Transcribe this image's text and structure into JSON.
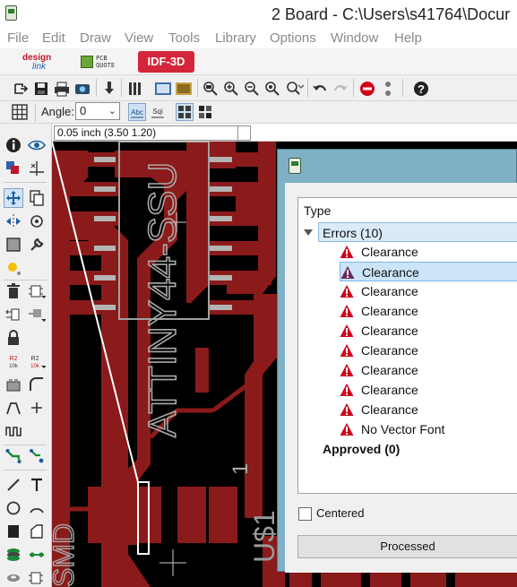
{
  "window": {
    "title": "2 Board - C:\\Users\\s41764\\Docur"
  },
  "menu": [
    "File",
    "Edit",
    "Draw",
    "View",
    "Tools",
    "Library",
    "Options",
    "Window",
    "Help"
  ],
  "partners": {
    "designlink_line1": "design",
    "designlink_line2": "link",
    "pcbquote_line1": "PCB",
    "pcbquote_line2": "QUOTE",
    "idf_button": "IDF-3D"
  },
  "toolbar2": {
    "angle_label": "Angle:",
    "angle_value": "0"
  },
  "coordinate_readout": "0.05 inch (3.50 1.20)",
  "board": {
    "chip_label": "ATTINY44-SSU",
    "pin_label": "1",
    "partial_label_left": "SMD",
    "partial_label_right": "U$1"
  },
  "drc_dialog": {
    "column_header": "Type",
    "errors_group": "Errors (10)",
    "errors": [
      "Clearance",
      "Clearance",
      "Clearance",
      "Clearance",
      "Clearance",
      "Clearance",
      "Clearance",
      "Clearance",
      "Clearance",
      "No Vector Font"
    ],
    "approved_group": "Approved (0)",
    "centered_label": "Centered",
    "centered_checked": false,
    "processed_button": "Processed"
  },
  "colors": {
    "copper": "#8b1a1a",
    "silkscreen": "#c0c0c0",
    "canvas": "#000000",
    "dialog_frame": "#7fb0c5",
    "error_icon": "#d0021b",
    "idf_button": "#d4263a"
  }
}
